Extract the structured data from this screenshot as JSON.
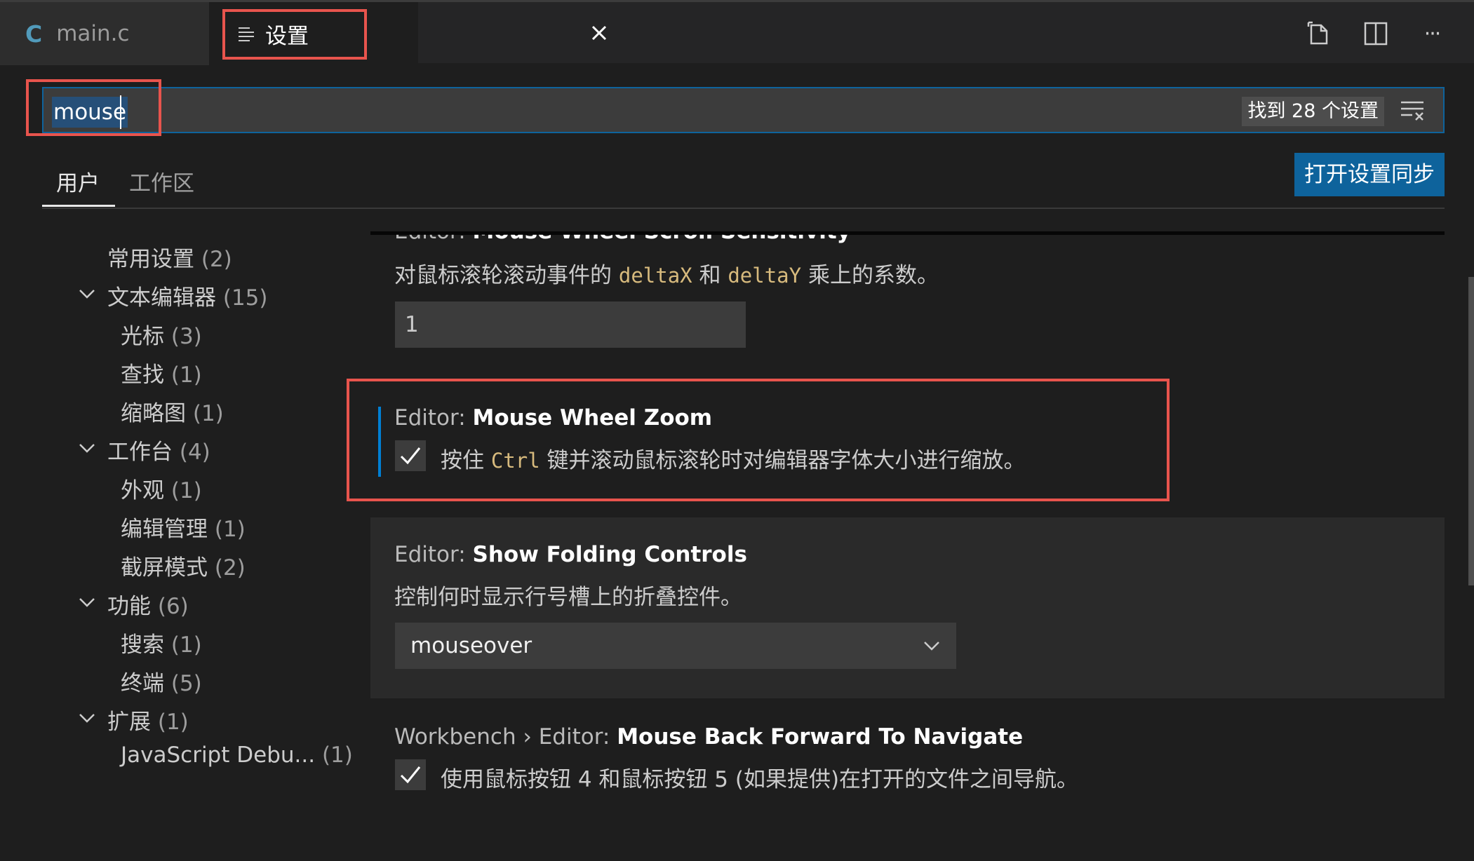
{
  "tabs": {
    "main": {
      "icon_letter": "C",
      "label": "main.c"
    },
    "settings": {
      "label": "设置"
    }
  },
  "actions": [
    "open-json-icon",
    "split-editor-icon",
    "more-actions-icon"
  ],
  "actions_text": {
    "more": "···"
  },
  "search": {
    "value": "mouse",
    "count": "找到 28 个设置"
  },
  "scopes": {
    "user": "用户",
    "workspace": "工作区"
  },
  "sync_button": "打开设置同步",
  "toc": {
    "common": {
      "label": "常用设置",
      "count": "(2)"
    },
    "text_editor": {
      "label": "文本编辑器",
      "count": "(15)"
    },
    "cursor": {
      "label": "光标",
      "count": "(3)"
    },
    "find": {
      "label": "查找",
      "count": "(1)"
    },
    "minimap": {
      "label": "缩略图",
      "count": "(1)"
    },
    "workbench": {
      "label": "工作台",
      "count": "(4)"
    },
    "appearance": {
      "label": "外观",
      "count": "(1)"
    },
    "editor_mgmt": {
      "label": "编辑管理",
      "count": "(1)"
    },
    "screencast": {
      "label": "截屏模式",
      "count": "(2)"
    },
    "features": {
      "label": "功能",
      "count": "(6)"
    },
    "search": {
      "label": "搜索",
      "count": "(1)"
    },
    "terminal": {
      "label": "终端",
      "count": "(5)"
    },
    "extensions": {
      "label": "扩展",
      "count": "(1)"
    },
    "js_debug": {
      "label": "JavaScript Debu...",
      "count": "(1)"
    }
  },
  "settings": {
    "scroll_sensitivity": {
      "cat": "Editor: ",
      "title": "Mouse Wheel Scroll Sensitivity",
      "desc_a": "对鼠标滚轮滚动事件的 ",
      "code_a": "deltaX",
      "desc_b": " 和 ",
      "code_b": "deltaY",
      "desc_c": " 乘上的系数。",
      "value": "1"
    },
    "wheel_zoom": {
      "cat": "Editor: ",
      "title": "Mouse Wheel Zoom",
      "desc_a": "按住 ",
      "code": "Ctrl",
      "desc_b": " 键并滚动鼠标滚轮时对编辑器字体大小进行缩放。",
      "checked": true
    },
    "folding": {
      "cat": "Editor: ",
      "title": "Show Folding Controls",
      "desc": "控制何时显示行号槽上的折叠控件。",
      "value": "mouseover"
    },
    "back_forward": {
      "cat": "Workbench › Editor: ",
      "title": "Mouse Back Forward To Navigate",
      "desc": "使用鼠标按钮 4 和鼠标按钮 5 (如果提供)在打开的文件之间导航。",
      "checked": true
    }
  },
  "colors": {
    "accent": "#0e639c",
    "highlight": "#e8544d",
    "code": "#d7ba7d"
  }
}
